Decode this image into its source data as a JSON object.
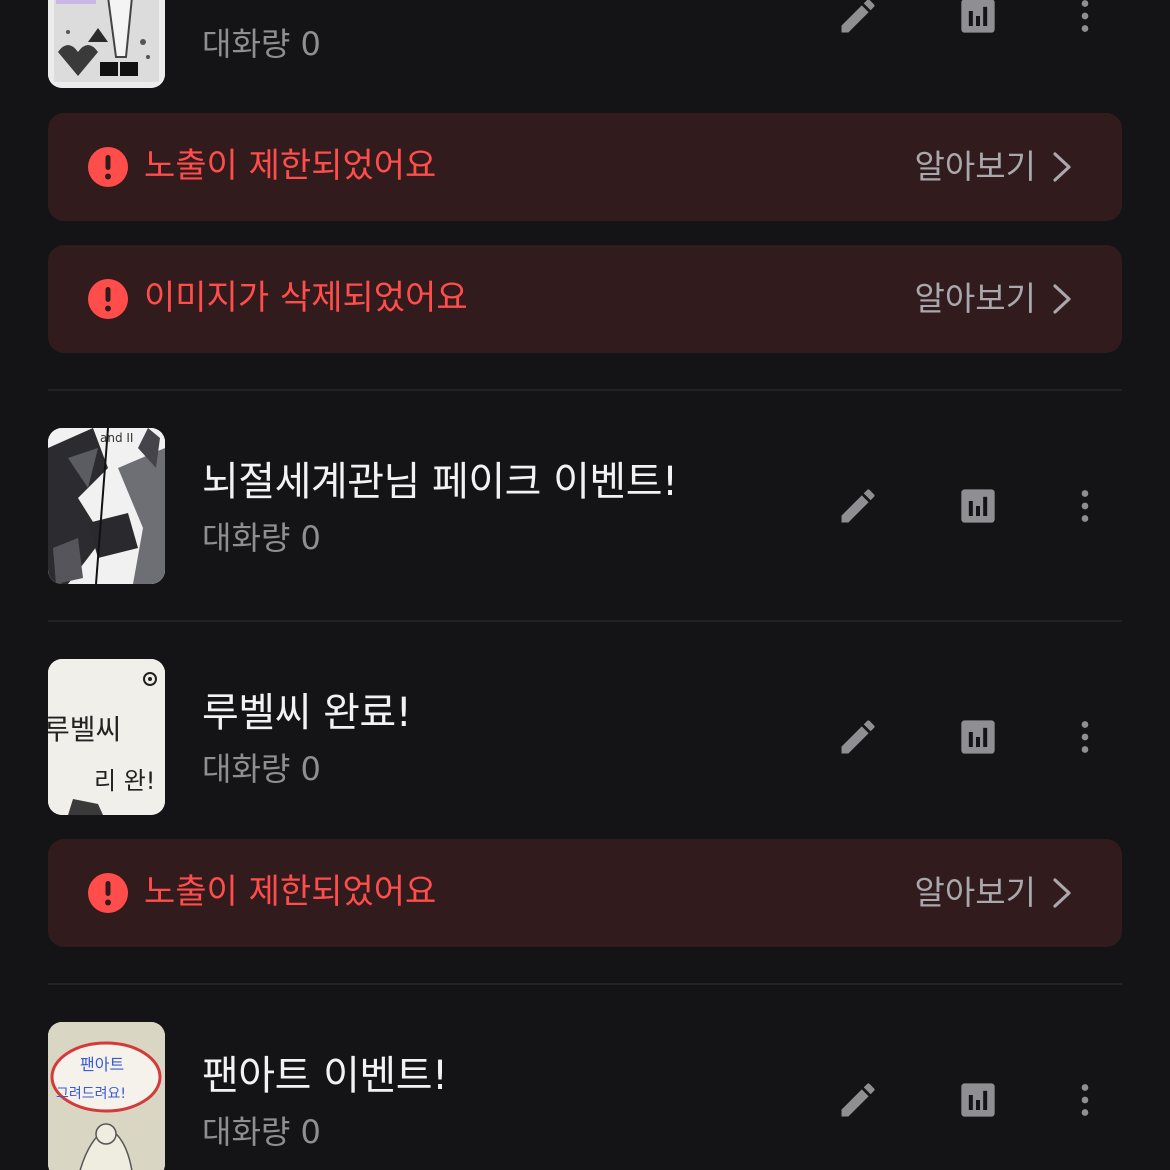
{
  "items": [
    {
      "title": "",
      "meta": "대화량 0"
    },
    {
      "title": "뇌절세계관님 페이크 이벤트!",
      "meta": "대화량 0",
      "thumb_text": "and II"
    },
    {
      "title": "루벨씨 완료!",
      "meta": "대화량 0",
      "thumb_text_1": "루벨씨",
      "thumb_text_2": "리 완!"
    },
    {
      "title": "팬아트 이벤트!",
      "meta": "대화량 0",
      "thumb_text_1": "팬아트",
      "thumb_text_2": "그려드려요!"
    }
  ],
  "banners": [
    {
      "text": "노출이 제한되었어요",
      "link": "알아보기"
    },
    {
      "text": "이미지가 삭제되었어요",
      "link": "알아보기"
    },
    {
      "text": "노출이 제한되었어요",
      "link": "알아보기"
    }
  ],
  "icons": {
    "edit": "pencil-icon",
    "stats": "bar-chart-icon",
    "more": "more-vertical-icon",
    "alert": "alert-circle-icon",
    "chevron": "chevron-right-icon"
  },
  "colors": {
    "background": "#141416",
    "banner_bg": "#321b1d",
    "alert_red": "#ff4d4b",
    "icon_gray": "#8e8e93",
    "title": "#f2f2f2"
  }
}
